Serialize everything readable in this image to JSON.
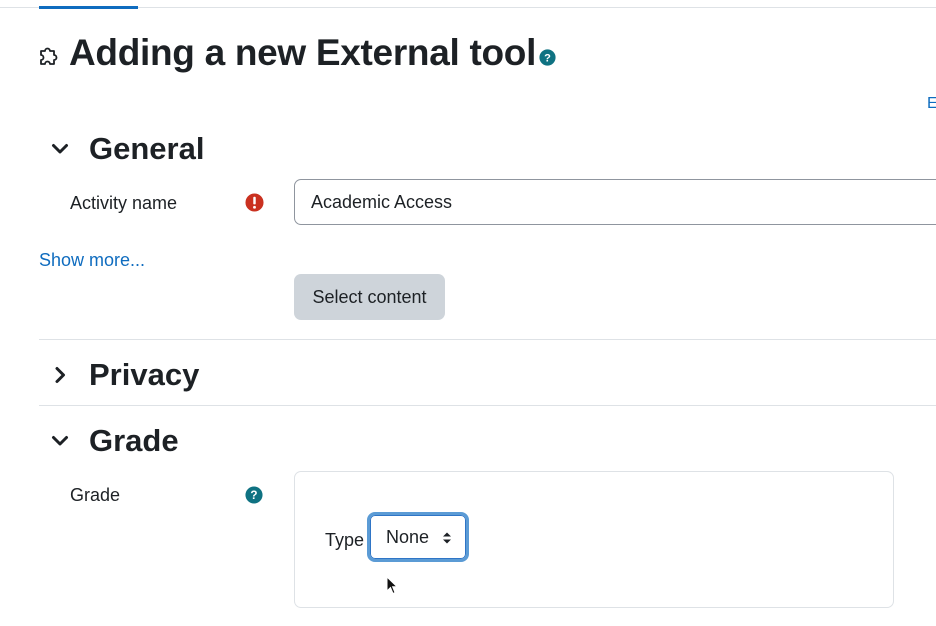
{
  "page": {
    "title": "Adding a new External tool",
    "expand_all_text": "E"
  },
  "icons": {
    "title_icon": "puzzle-piece-icon",
    "title_help": "help-icon",
    "required": "exclamation-circle-icon",
    "grade_help": "help-icon",
    "accent_color": "#0f6cbf",
    "help_color": "#0f7282",
    "required_color": "#ca3120"
  },
  "sections": {
    "general": {
      "title": "General",
      "expanded": true,
      "activity_name_label": "Activity name",
      "activity_name_value": "Academic Access",
      "show_more": "Show more...",
      "select_content_button": "Select content"
    },
    "privacy": {
      "title": "Privacy",
      "expanded": false
    },
    "grade": {
      "title": "Grade",
      "expanded": true,
      "grade_label": "Grade",
      "type_label": "Type",
      "type_value": "None"
    }
  }
}
